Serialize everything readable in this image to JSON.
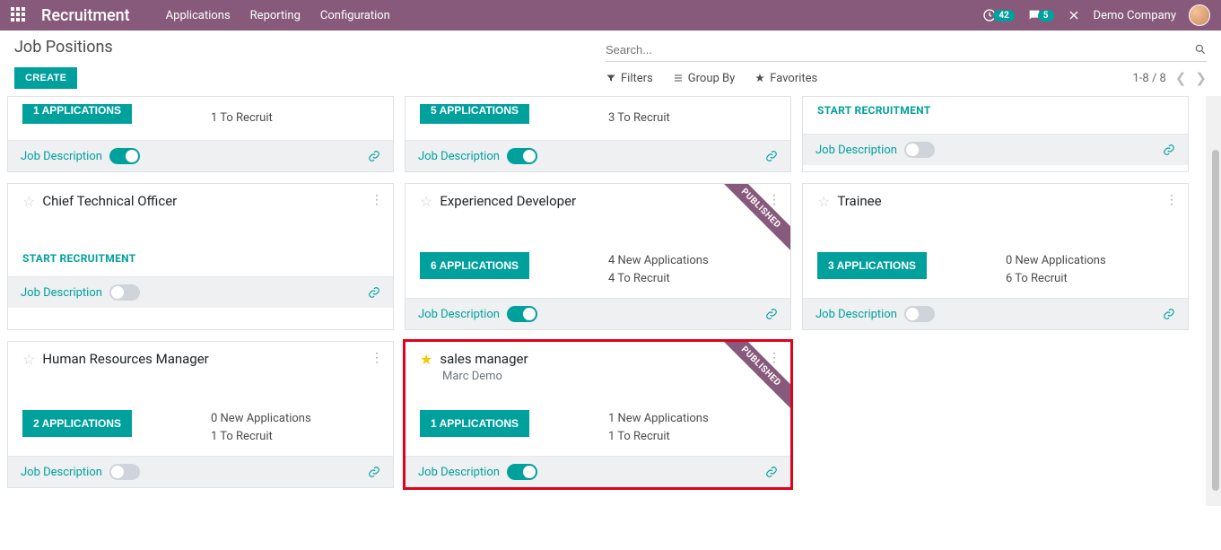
{
  "navbar": {
    "brand": "Recruitment",
    "menu": [
      "Applications",
      "Reporting",
      "Configuration"
    ],
    "activity_count": "42",
    "messages_count": "5",
    "company": "Demo Company"
  },
  "page": {
    "title": "Job Positions",
    "search_placeholder": "Search...",
    "create": "CREATE",
    "filters": "Filters",
    "groupby": "Group By",
    "favorites": "Favorites",
    "pager": "1-8 / 8"
  },
  "labels": {
    "job_description": "Job Description",
    "start_recruitment": "START RECRUITMENT",
    "published": "PUBLISHED"
  },
  "cards": {
    "r1c1": {
      "apps_btn": "1 APPLICATIONS",
      "line2": "1 To Recruit"
    },
    "r1c2": {
      "apps_btn": "5 APPLICATIONS",
      "line2": "3 To Recruit"
    },
    "r1c3": {},
    "r2c1": {
      "title": "Chief Technical Officer"
    },
    "r2c2": {
      "title": "Experienced Developer",
      "apps_btn": "6 APPLICATIONS",
      "line1": "4 New Applications",
      "line2": "4 To Recruit"
    },
    "r2c3": {
      "title": "Trainee",
      "apps_btn": "3 APPLICATIONS",
      "line1": "0 New Applications",
      "line2": "6 To Recruit"
    },
    "r3c1": {
      "title": "Human Resources Manager",
      "apps_btn": "2 APPLICATIONS",
      "line1": "0 New Applications",
      "line2": "1 To Recruit"
    },
    "r3c2": {
      "title": "sales manager",
      "sub": "Marc Demo",
      "apps_btn": "1 APPLICATIONS",
      "line1": "1 New Applications",
      "line2": "1 To Recruit"
    }
  }
}
